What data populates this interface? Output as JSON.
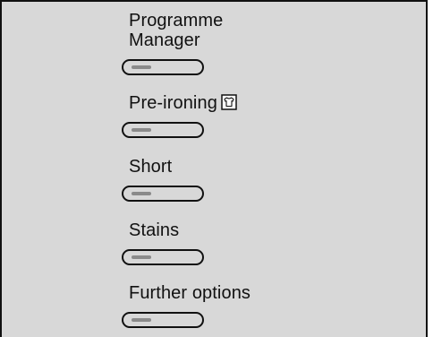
{
  "menu": {
    "items": [
      {
        "label_line1": "Programme",
        "label_line2": "Manager"
      },
      {
        "label": "Pre-ironing",
        "icon": "shirt-icon"
      },
      {
        "label": "Short"
      },
      {
        "label": "Stains"
      },
      {
        "label": "Further options"
      }
    ]
  },
  "colors": {
    "panel_background": "#d8d8d8",
    "border": "#111111",
    "button_indicator": "#8a8a8a"
  }
}
